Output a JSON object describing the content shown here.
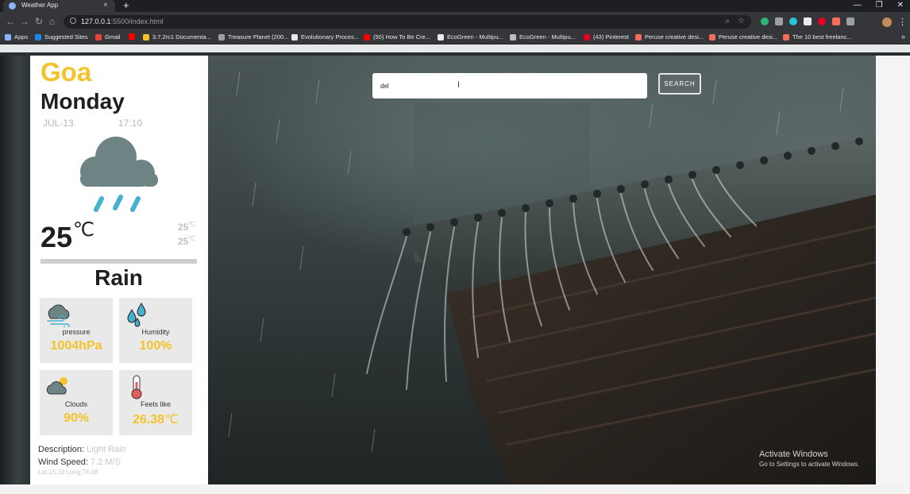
{
  "browser": {
    "tab_title": "Weather App",
    "tab_close": "×",
    "new_tab": "+",
    "url_host": "127.0.0.1",
    "url_rest": ":5500/index.html",
    "window_controls": [
      "—",
      "❐",
      "✕"
    ],
    "bookmarks": [
      {
        "label": "Apps",
        "icon_color": "#8ab4f8"
      },
      {
        "label": "Suggested Sites",
        "icon_color": "#1e88e5"
      },
      {
        "label": "Gmail",
        "icon_color": "#ea4335"
      },
      {
        "label": "",
        "icon_color": "#ff0000"
      },
      {
        "label": "3.7.2rc1 Documenta...",
        "icon_color": "#f4c329"
      },
      {
        "label": "Treasure Planet (200...",
        "icon_color": "#9e9e9e"
      },
      {
        "label": "Evolutionary Proces...",
        "icon_color": "#e8eaed"
      },
      {
        "label": "(50) How To Be Cre...",
        "icon_color": "#ff0000"
      },
      {
        "label": "EcoGreen - Multipu...",
        "icon_color": "#e8eaed"
      },
      {
        "label": "EcoGreen - Multipu...",
        "icon_color": "#bbbbbb"
      },
      {
        "label": "(43) Pinterest",
        "icon_color": "#e60023"
      },
      {
        "label": "Peruse creative desi...",
        "icon_color": "#f26b5b"
      },
      {
        "label": "Peruse creative desi...",
        "icon_color": "#f26b5b"
      },
      {
        "label": "The 10 best freelanc...",
        "icon_color": "#f26b5b"
      }
    ]
  },
  "weather": {
    "city": "Goa",
    "day": "Monday",
    "date": "JUL-13",
    "time": "17:10",
    "temp": "25",
    "unit": "℃",
    "temp_max": "25",
    "temp_min": "25",
    "condition": "Rain",
    "tiles": [
      {
        "label": "pressure",
        "value": "1004hPa",
        "icon": "wind-cloud-icon"
      },
      {
        "label": "Humidity",
        "value": "100%",
        "icon": "water-drops-icon"
      },
      {
        "label": "Clouds",
        "value": "90%",
        "icon": "cloud-sun-icon"
      },
      {
        "label": "Feels like",
        "value": "26.38",
        "unit": "℃",
        "icon": "thermometer-icon"
      }
    ],
    "description_label": "Description:",
    "description_value": "Light Rain",
    "wind_label": "Wind Speed:",
    "wind_value": "7.2 M/S",
    "latlong": "Lat:15.33 Long:74.08"
  },
  "search": {
    "value": "del",
    "button_label": "SEARCH"
  },
  "watermark": {
    "line1": "Activate Windows",
    "line2": "Go to Settings to activate Windows."
  },
  "colors": {
    "accent": "#f4c329",
    "cloud": "#6e8383",
    "rain": "#45b1d1"
  }
}
